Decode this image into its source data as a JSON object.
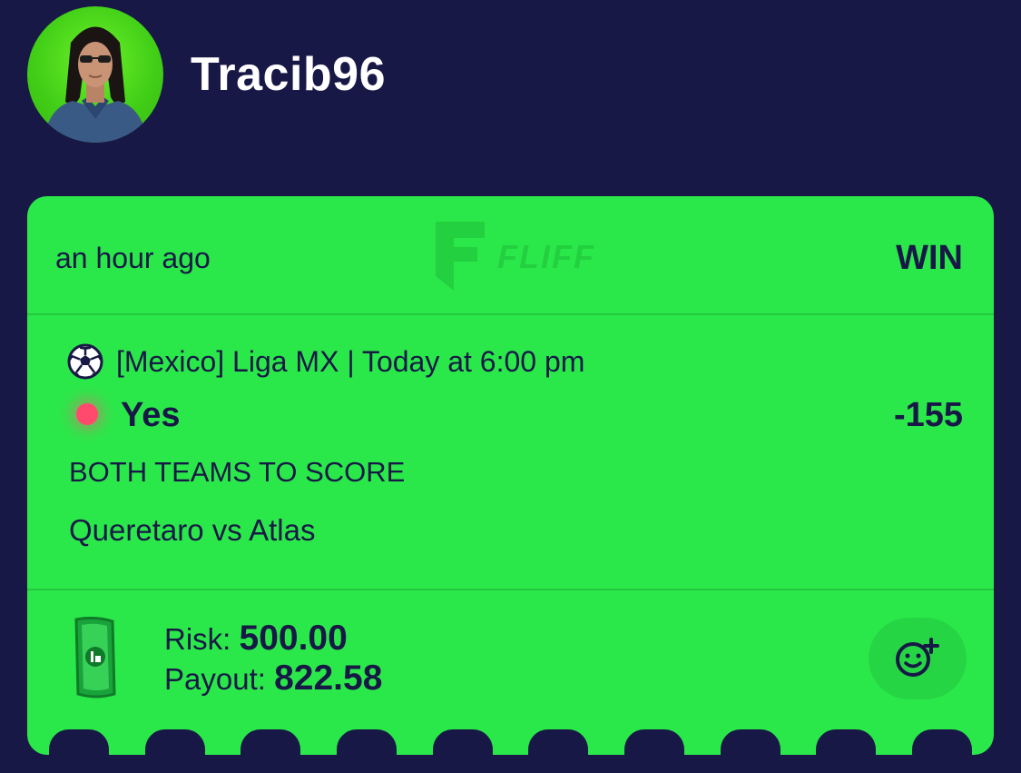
{
  "header": {
    "username": "Tracib96",
    "avatar_icon": "user-avatar"
  },
  "bet": {
    "time_ago": "an hour ago",
    "logo_text": "FLIFF",
    "result": "WIN",
    "sport_icon": "soccer-ball-icon",
    "event": "[Mexico] Liga MX | Today at 6:00 pm",
    "pick": "Yes",
    "odds": "-155",
    "market": "BOTH TEAMS TO SCORE",
    "matchup": "Queretaro vs Atlas",
    "risk_label": "Risk:",
    "risk_value": "500.00",
    "payout_label": "Payout:",
    "payout_value": "822.58",
    "react_icon": "add-emoji-icon"
  },
  "colors": {
    "background": "#181846",
    "card": "#2be84a",
    "text": "#181846",
    "live_dot": "#ff4a6e"
  }
}
